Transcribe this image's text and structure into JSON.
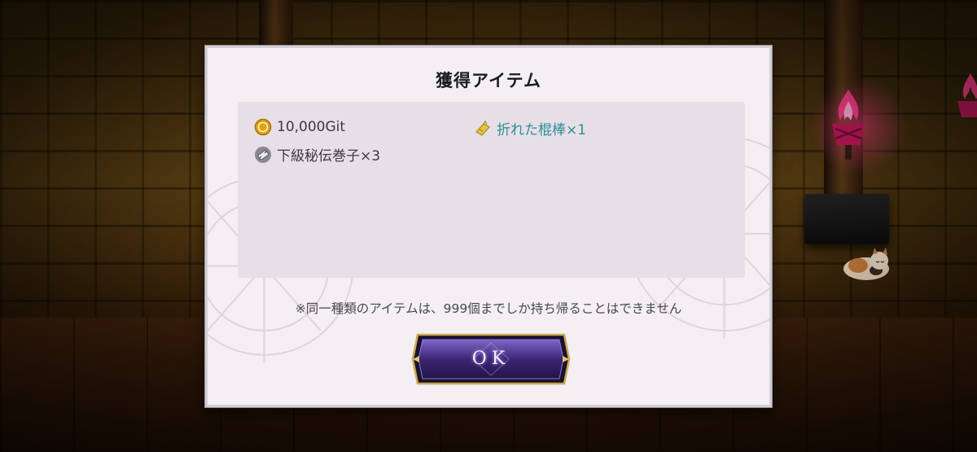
{
  "dialog": {
    "title": "獲得アイテム",
    "items": [
      {
        "icon": "gold-coin-icon",
        "label": "10,000Git"
      },
      {
        "icon": "broken-stick-icon",
        "label": "折れた棍棒×1"
      },
      {
        "icon": "scroll-icon",
        "label": "下級秘伝巻子×3"
      }
    ],
    "notice": "※同一種類のアイテムは、999個までしか持ち帰ることはできません",
    "ok_label": "OK"
  },
  "colors": {
    "panel_bg": "#f3eff3",
    "items_bg": "#e7dfe6",
    "rare_item_text": "#2a8f98",
    "button_accent": "#4a2f8a"
  }
}
